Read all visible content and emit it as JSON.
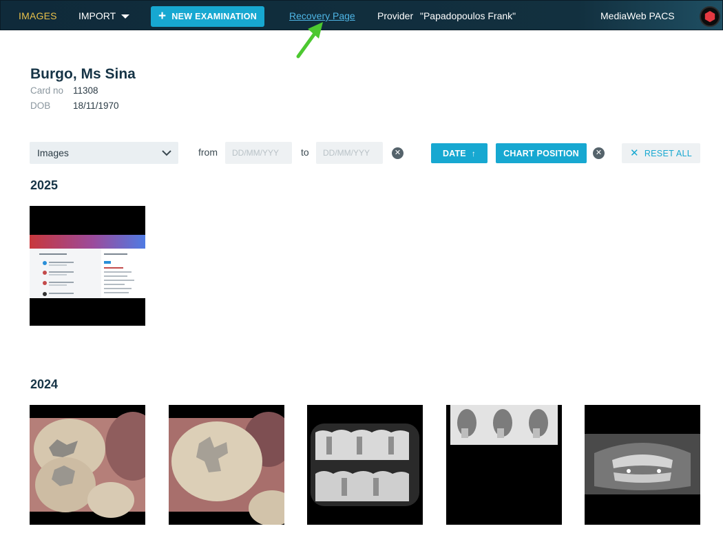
{
  "nav": {
    "images": "IMAGES",
    "import": "IMPORT",
    "new_examination": "NEW EXAMINATION",
    "recovery_page": "Recovery Page",
    "provider_label": "Provider",
    "provider_name": "\"Papadopoulos Frank\"",
    "app_name": "MediaWeb PACS"
  },
  "patient": {
    "name": "Burgo, Ms Sina",
    "card_label": "Card no",
    "card_value": "11308",
    "dob_label": "DOB",
    "dob_value": "18/11/1970"
  },
  "filters": {
    "type_selected": "Images",
    "from_label": "from",
    "to_label": "to",
    "date_placeholder": "DD/MM/YYY",
    "sort_date": "DATE",
    "chart_position": "CHART POSITION",
    "reset_all": "RESET ALL"
  },
  "sections": [
    {
      "year": "2025"
    },
    {
      "year": "2024"
    }
  ],
  "colors": {
    "accent": "#17a8d1",
    "nav_bg": "#12303f",
    "active_nav": "#e8c04a",
    "annotation_arrow": "#4cc830"
  }
}
